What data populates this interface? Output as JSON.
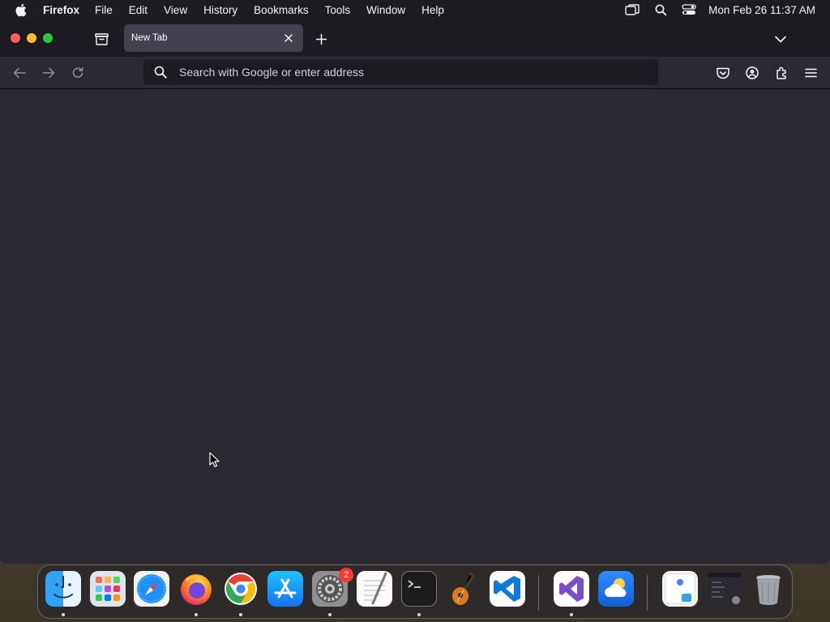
{
  "menubar": {
    "app_name": "Firefox",
    "items": [
      "File",
      "Edit",
      "View",
      "History",
      "Bookmarks",
      "Tools",
      "Window",
      "Help"
    ],
    "clock": "Mon Feb 26  11:37 AM"
  },
  "browser": {
    "tabs": [
      {
        "title": "New Tab",
        "active": true
      }
    ],
    "urlbar": {
      "placeholder": "Search with Google or enter address",
      "value": ""
    }
  },
  "dock": {
    "apps": [
      "Finder",
      "Launchpad",
      "Safari",
      "Firefox",
      "Google Chrome",
      "App Store",
      "System Settings",
      "TextEdit",
      "Terminal",
      "GarageBand",
      "Visual Studio Code",
      "Visual Studio",
      "Weather"
    ],
    "settings_badge": "2"
  },
  "colors": {
    "menubar_bg": "#1d1c21",
    "tabstrip_bg": "#1c1b22",
    "toolbar_bg": "#2b2a33",
    "active_tab_bg": "#42414d",
    "content_bg": "#2b2a33"
  }
}
